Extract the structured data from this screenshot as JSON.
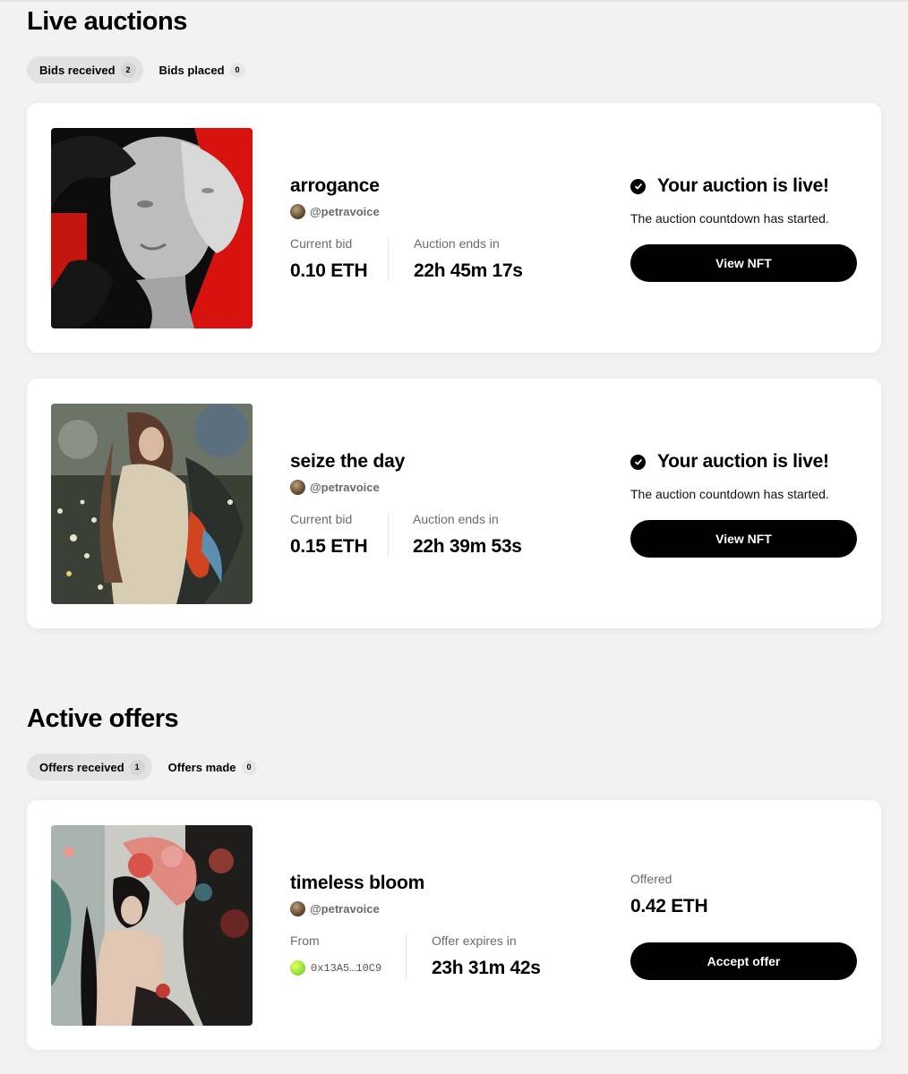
{
  "live_auctions": {
    "title": "Live auctions",
    "tabs": [
      {
        "label": "Bids received",
        "count": "2",
        "active": true
      },
      {
        "label": "Bids placed",
        "count": "0",
        "active": false
      }
    ],
    "cards": [
      {
        "title": "arrogance",
        "creator": "@petravoice",
        "current_bid_label": "Current bid",
        "current_bid": "0.10 ETH",
        "ends_label": "Auction ends in",
        "ends": "22h 45m 17s",
        "status_heading": "Your auction is live!",
        "status_sub": "The auction countdown has started.",
        "button": "View NFT"
      },
      {
        "title": "seize the day",
        "creator": "@petravoice",
        "current_bid_label": "Current bid",
        "current_bid": "0.15 ETH",
        "ends_label": "Auction ends in",
        "ends": "22h 39m 53s",
        "status_heading": "Your auction is live!",
        "status_sub": "The auction countdown has started.",
        "button": "View NFT"
      }
    ]
  },
  "active_offers": {
    "title": "Active offers",
    "tabs": [
      {
        "label": "Offers received",
        "count": "1",
        "active": true
      },
      {
        "label": "Offers made",
        "count": "0",
        "active": false
      }
    ],
    "cards": [
      {
        "title": "timeless bloom",
        "creator": "@petravoice",
        "from_label": "From",
        "from_wallet": "0x13A5…10C9",
        "expires_label": "Offer expires in",
        "expires": "23h 31m 42s",
        "offered_label": "Offered",
        "offered": "0.42 ETH",
        "button": "Accept offer"
      }
    ]
  },
  "colors": {
    "background": "#f2f2f2",
    "card": "#ffffff",
    "button": "#000000",
    "accent_red": "#d8130f"
  }
}
